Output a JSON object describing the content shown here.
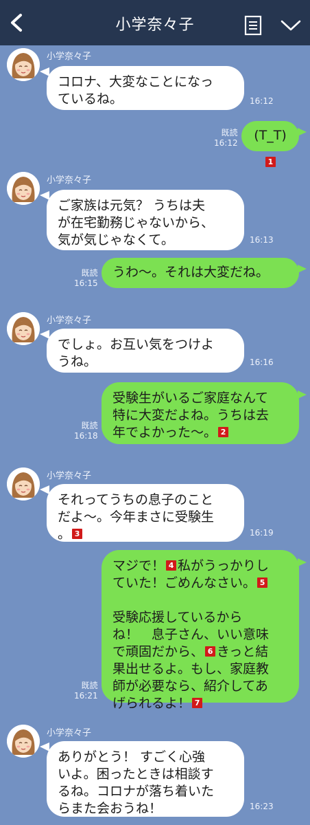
{
  "header": {
    "title": "小学奈々子",
    "back_icon": "chevron-left-icon",
    "menu_icon": "note-list-icon",
    "toggle_icon": "chevron-down-icon"
  },
  "contact": {
    "name": "小学奈々子"
  },
  "messages": [
    {
      "dir": "in",
      "text": "コロナ、大変なことになっ\nているね。",
      "time": "16:12"
    },
    {
      "dir": "out",
      "text": "(T_T)",
      "read": "既読",
      "time": "16:12",
      "badge": "1"
    },
    {
      "dir": "in",
      "text": "ご家族は元気？ うちは夫\nが在宅勤務じゃないから、\n気が気じゃなくて。",
      "time": "16:13"
    },
    {
      "dir": "out",
      "text": "うわ〜。それは大変だね。",
      "read": "既読",
      "time": "16:15"
    },
    {
      "dir": "in",
      "text": "でしょ。お互い気をつけよ\nうね。",
      "time": "16:16"
    },
    {
      "dir": "out",
      "text_parts": [
        "受験生がいるご家庭なんて\n特に大変だよね。うちは去\n年でよかった〜。"
      ],
      "badges": [
        "2"
      ],
      "read": "既読",
      "time": "16:18"
    },
    {
      "dir": "in",
      "text_parts": [
        "それってうちの息子のこと\nだよ〜。今年まさに受験生\n。"
      ],
      "badges": [
        "3"
      ],
      "time": "16:19"
    },
    {
      "dir": "out",
      "text_parts": [
        "マジで！",
        "私がうっかりし\nていた！ごめんなさい。",
        "\n\n受験応援しているから\nね！　息子さん、いい意味\nで頑固だから、",
        "きっと結\n果出せるよ。もし、家庭教\n師が必要なら、紹介してあ\nげられるよ！"
      ],
      "badges": [
        "4",
        "5",
        "6",
        "7"
      ],
      "read": "既読",
      "time": "16:21"
    },
    {
      "dir": "in",
      "text": "ありがとう！ すごく心強\nいよ。困ったときは相談す\nるね。コロナが落ち着いた\nらまた会おうね！",
      "time": "16:23"
    }
  ],
  "colors": {
    "background": "#7391c2",
    "header": "#263650",
    "outgoing": "#7ce052",
    "incoming": "#ffffff",
    "badge": "#d11a1a"
  }
}
